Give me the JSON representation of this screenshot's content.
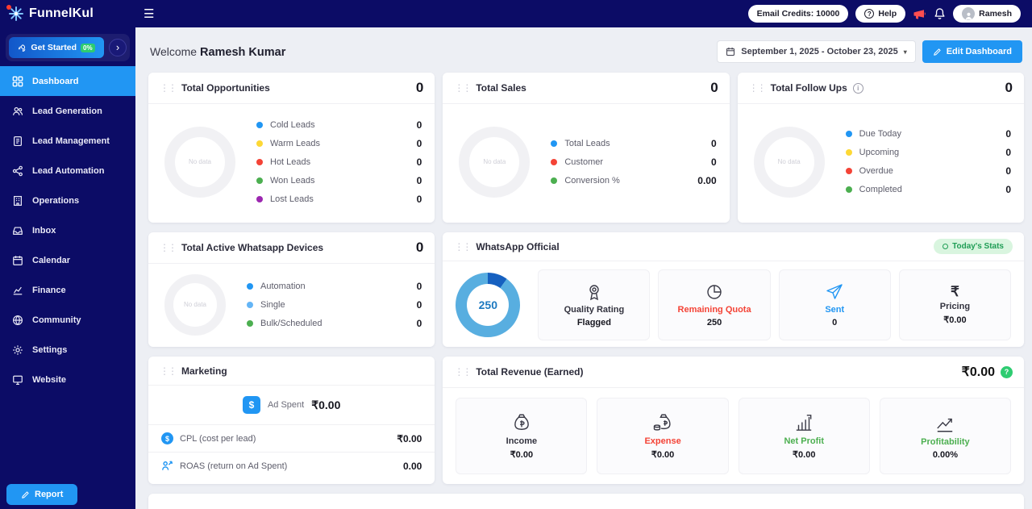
{
  "icons": {
    "menu": "☰",
    "drag_handle": "⋮⋮",
    "chevron_right": "›",
    "caret_down": "▾",
    "question": "?",
    "info": "i",
    "dollar": "$",
    "rupee": "₹"
  },
  "colors": {
    "navy": "#0c0c66",
    "accent_blue": "#2196f3",
    "red": "#f44336",
    "green": "#4caf50",
    "yellow": "#fdd835",
    "purple": "#9c27b0"
  },
  "topbar": {
    "brand": "FunnelKul",
    "email_credits_label": "Email Credits: 10000",
    "help_label": "Help",
    "user_name": "Ramesh"
  },
  "sidebar": {
    "get_started_label": "Get Started",
    "get_started_progress": "0%",
    "items": [
      {
        "label": "Dashboard"
      },
      {
        "label": "Lead Generation"
      },
      {
        "label": "Lead Management"
      },
      {
        "label": "Lead Automation"
      },
      {
        "label": "Operations"
      },
      {
        "label": "Inbox"
      },
      {
        "label": "Calendar"
      },
      {
        "label": "Finance"
      },
      {
        "label": "Community"
      },
      {
        "label": "Settings"
      },
      {
        "label": "Website"
      }
    ],
    "report_label": "Report"
  },
  "header": {
    "welcome_prefix": "Welcome",
    "user_name": "Ramesh Kumar",
    "date_range": "September 1, 2025 - October 23, 2025",
    "edit_button": "Edit Dashboard"
  },
  "cards": {
    "opportunities": {
      "title": "Total Opportunities",
      "count": "0",
      "no_data": "No data",
      "legend": [
        {
          "label": "Cold Leads",
          "value": "0",
          "color": "#2196f3"
        },
        {
          "label": "Warm Leads",
          "value": "0",
          "color": "#fdd835"
        },
        {
          "label": "Hot Leads",
          "value": "0",
          "color": "#f44336"
        },
        {
          "label": "Won Leads",
          "value": "0",
          "color": "#4caf50"
        },
        {
          "label": "Lost Leads",
          "value": "0",
          "color": "#9c27b0"
        }
      ]
    },
    "sales": {
      "title": "Total Sales",
      "count": "0",
      "no_data": "No data",
      "legend": [
        {
          "label": "Total Leads",
          "value": "0",
          "color": "#2196f3"
        },
        {
          "label": "Customer",
          "value": "0",
          "color": "#f44336"
        },
        {
          "label": "Conversion %",
          "value": "0.00",
          "color": "#4caf50"
        }
      ]
    },
    "follow_ups": {
      "title": "Total Follow Ups",
      "count": "0",
      "no_data": "No data",
      "legend": [
        {
          "label": "Due Today",
          "value": "0",
          "color": "#2196f3"
        },
        {
          "label": "Upcoming",
          "value": "0",
          "color": "#fdd835"
        },
        {
          "label": "Overdue",
          "value": "0",
          "color": "#f44336"
        },
        {
          "label": "Completed",
          "value": "0",
          "color": "#4caf50"
        }
      ]
    },
    "whatsapp_devices": {
      "title": "Total Active Whatsapp Devices",
      "count": "0",
      "no_data": "No data",
      "legend": [
        {
          "label": "Automation",
          "value": "0",
          "color": "#2196f3"
        },
        {
          "label": "Single",
          "value": "0",
          "color": "#64b5f6"
        },
        {
          "label": "Bulk/Scheduled",
          "value": "0",
          "color": "#4caf50"
        }
      ]
    },
    "whatsapp_official": {
      "title": "WhatsApp Official",
      "badge": "Today's Stats",
      "donut_value": "250",
      "stats": [
        {
          "label": "Quality Rating",
          "value": "Flagged",
          "label_color": "#33333f"
        },
        {
          "label": "Remaining Quota",
          "value": "250",
          "label_color": "#f44336"
        },
        {
          "label": "Sent",
          "value": "0",
          "label_color": "#2196f3"
        },
        {
          "label": "Pricing",
          "value": "₹0.00",
          "label_color": "#33333f"
        }
      ]
    },
    "marketing": {
      "title": "Marketing",
      "ad_spent_label": "Ad Spent",
      "ad_spent_value": "₹0.00",
      "rows": [
        {
          "label": "CPL (cost per lead)",
          "value": "₹0.00"
        },
        {
          "label": "ROAS (return on Ad Spent)",
          "value": "0.00"
        }
      ]
    },
    "revenue": {
      "title": "Total Revenue (Earned)",
      "amount": "₹0.00",
      "stats": [
        {
          "label": "Income",
          "value": "₹0.00",
          "label_color": "#33333f"
        },
        {
          "label": "Expense",
          "value": "₹0.00",
          "label_color": "#f44336"
        },
        {
          "label": "Net Profit",
          "value": "₹0.00",
          "label_color": "#4caf50"
        },
        {
          "label": "Profitability",
          "value": "0.00%",
          "label_color": "#4caf50"
        }
      ]
    }
  }
}
